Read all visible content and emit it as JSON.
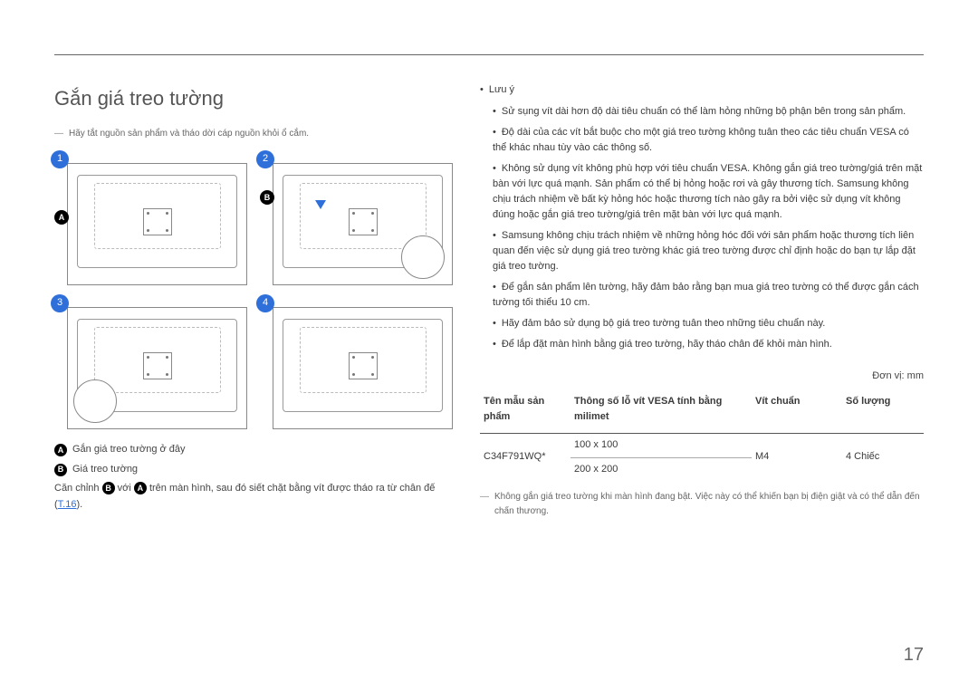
{
  "page_number": "17",
  "title": "Gắn giá treo tường",
  "top_note": "Hãy tắt nguồn sản phẩm và tháo dời cáp nguồn khỏi ổ cắm.",
  "steps": [
    "1",
    "2",
    "3",
    "4"
  ],
  "badge_A": "A",
  "badge_B": "B",
  "legend": {
    "a_label": "Gắn giá treo tường ở đây",
    "b_label": "Giá treo tường"
  },
  "instruction_prefix": "Căn chỉnh ",
  "instruction_mid1": " với ",
  "instruction_mid2": " trên màn hình, sau đó siết chặt bằng vít được tháo ra từ chân đế (",
  "instruction_link": "T.16",
  "instruction_suffix": ").",
  "notes_heading": "Lưu ý",
  "notes": [
    "Sử sụng vít dài hơn độ dài tiêu chuẩn có thể làm hỏng những bộ phận bên trong sản phẩm.",
    "Độ dài của các vít bắt buộc cho một giá treo tường không tuân theo các tiêu chuẩn VESA có thể khác nhau tùy vào các thông số.",
    "Không sử dụng vít không phù hợp với tiêu chuẩn VESA. Không gắn giá treo tường/giá trên mặt bàn với lực quá mạnh. Sản phẩm có thể bị hỏng hoặc rơi và gây thương tích. Samsung không chịu trách nhiệm về bất kỳ hỏng hóc hoặc thương tích nào gây ra bởi việc sử dụng vít không đúng hoặc gắn giá treo tường/giá trên mặt bàn với lực quá mạnh.",
    "Samsung không chịu trách nhiệm về những hỏng hóc đối với sản phẩm hoặc thương tích liên quan đến việc sử dụng giá treo tường khác giá treo tường được chỉ định hoặc do bạn tự lắp đặt giá treo tường.",
    "Để gắn sản phẩm lên tường, hãy đảm bảo rằng bạn mua giá treo tường có thể được gắn cách tường tối thiểu 10 cm.",
    "Hãy đảm bảo sử dụng bộ giá treo tường tuân theo những tiêu chuẩn này.",
    "Để lắp đặt màn hình bằng giá treo tường, hãy tháo chân đế khỏi màn hình."
  ],
  "unit_label": "Đơn vị: mm",
  "table": {
    "headers": {
      "model": "Tên mẫu sản phẩm",
      "vesa": "Thông số lỗ vít VESA tính bằng milimet",
      "screw": "Vít chuẩn",
      "qty": "Số lượng"
    },
    "rows": [
      {
        "model": "C34F791WQ*",
        "dims": [
          "100 x 100",
          "200 x 200"
        ],
        "screw": "M4",
        "qty": "4 Chiếc"
      }
    ]
  },
  "bottom_note": "Không gắn giá treo tường khi màn hình đang bật. Việc này có thể khiến bạn bị điện giật và có thể dẫn đến chấn thương."
}
